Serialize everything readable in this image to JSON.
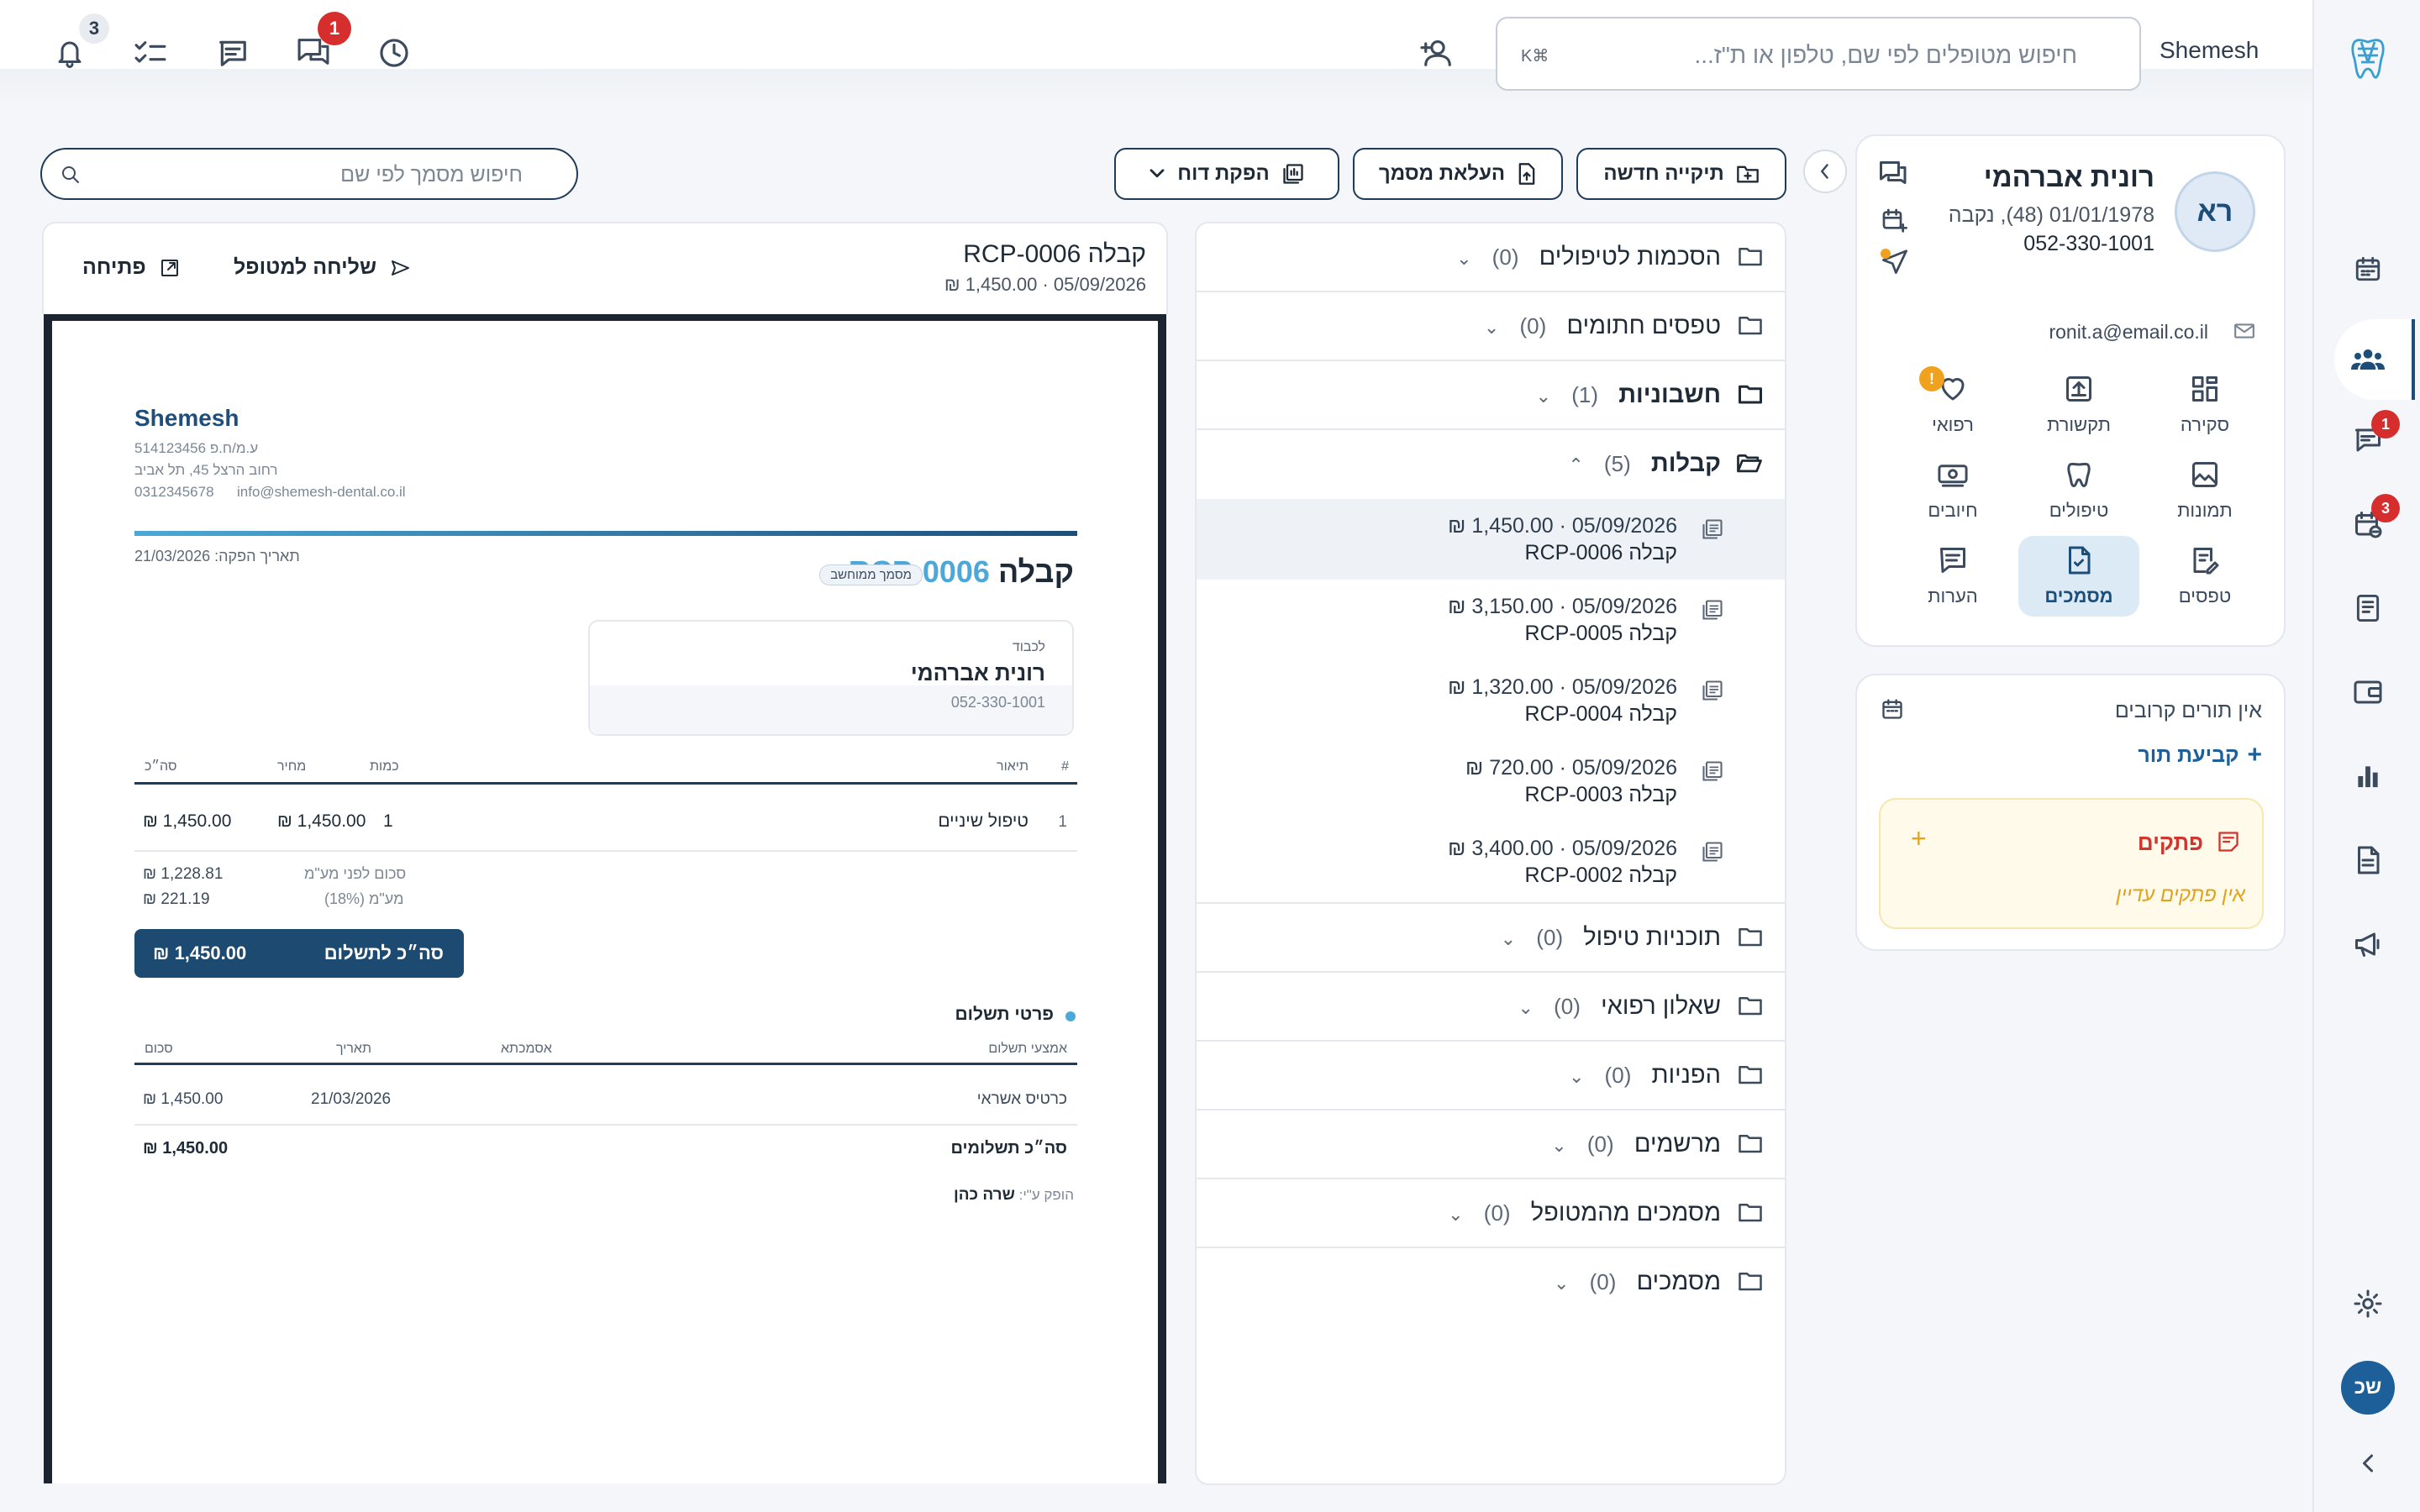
{
  "topbar": {
    "brand": "Shemesh",
    "search_placeholder": "חיפוש מטופלים לפי שם, טלפון או ת\"ז...",
    "kbd_hint": "K⌘",
    "notifications_count": "3",
    "messages_count": "1"
  },
  "rail": {
    "user_initials": "שכ",
    "messages_badge": "1",
    "calendar_badge": "3"
  },
  "patient": {
    "name": "רונית אברהמי",
    "initials": "רא",
    "details": "01/01/1978 (48), נקבה",
    "phone": "052-330-1001",
    "email": "ronit.a@email.co.il",
    "tiles": [
      "סקירה",
      "תקשורת",
      "רפואי",
      "תמונות",
      "טיפולים",
      "חיובים",
      "טפסים",
      "מסמכים",
      "הערות"
    ],
    "medical_alert": "!"
  },
  "appointments": {
    "none_text": "אין תורים קרובים",
    "book_label": "קביעת תור"
  },
  "notes": {
    "title": "פתקים",
    "empty": "אין פתקים עדיין"
  },
  "toolbar": {
    "new_folder": "תיקייה חדשה",
    "upload": "העלאת מסמך",
    "report": "הפקת דוח",
    "doc_search_placeholder": "חיפוש מסמך לפי שם"
  },
  "folders": [
    {
      "label": "הסכמות לטיפולים",
      "count": "(0)"
    },
    {
      "label": "טפסים חתומים",
      "count": "(0)"
    },
    {
      "label": "חשבוניות",
      "count": "(1)"
    },
    {
      "label": "קבלות",
      "count": "(5)"
    },
    {
      "label": "תוכניות טיפול",
      "count": "(0)"
    },
    {
      "label": "שאלון רפואי",
      "count": "(0)"
    },
    {
      "label": "הפניות",
      "count": "(0)"
    },
    {
      "label": "מרשמים",
      "count": "(0)"
    },
    {
      "label": "מסמכים מהמטופל",
      "count": "(0)"
    },
    {
      "label": "מסמכים",
      "count": "(0)"
    }
  ],
  "receipts": [
    {
      "meta": "₪ 1,450.00 · 05/09/2026",
      "name": "קבלה RCP-0006"
    },
    {
      "meta": "₪ 3,150.00 · 05/09/2026",
      "name": "קבלה RCP-0005"
    },
    {
      "meta": "₪ 1,320.00 · 05/09/2026",
      "name": "קבלה RCP-0004"
    },
    {
      "meta": "₪ 720.00 · 05/09/2026",
      "name": "קבלה RCP-0003"
    },
    {
      "meta": "₪ 3,400.00 · 05/09/2026",
      "name": "קבלה RCP-0002"
    }
  ],
  "preview": {
    "title": "קבלה RCP-0006",
    "meta": "₪ 1,450.00 · 05/09/2026",
    "send_label": "שליחה למטופל",
    "open_label": "פתיחה"
  },
  "doc": {
    "clinic": "Shemesh",
    "tax_id": "ע.מ/ח.פ 514123456",
    "address": "רחוב הרצל 45, תל אביב",
    "phone": "0312345678",
    "email": "info@shemesh-dental.co.il",
    "issue_date": "תאריך הפקה: 21/03/2026",
    "doc_word": "קבלה",
    "doc_number": "RCP-0006",
    "computerized": "מסמך ממוחשב",
    "to_label": "לכבוד",
    "to_name": "רונית אברהמי",
    "to_phone": "052-330-1001",
    "cols": {
      "num": "#",
      "desc": "תיאור",
      "qty": "כמות",
      "price": "מחיר",
      "total": "סה״כ"
    },
    "line": {
      "num": "1",
      "desc": "טיפול שיניים",
      "qty": "1",
      "price": "1,450.00 ₪",
      "total": "1,450.00 ₪"
    },
    "subtotal_label": "סכום לפני מע\"מ",
    "subtotal": "1,228.81 ₪",
    "vat_label": "מע\"מ (18%)",
    "vat": "221.19 ₪",
    "grand_label": "סה״כ לתשלום",
    "grand": "1,450.00 ₪",
    "pay_title": "פרטי תשלום",
    "pay_cols": {
      "method": "אמצעי תשלום",
      "ref": "אסמכתא",
      "date": "תאריך",
      "amount": "סכום"
    },
    "pay_row": {
      "method": "כרטיס אשראי",
      "date": "21/03/2026",
      "amount": "1,450.00 ₪"
    },
    "pay_total_label": "סה״כ תשלומים",
    "pay_total": "1,450.00 ₪",
    "issued_by_label": "הופק ע\"י:",
    "issued_by": "שרה כהן"
  },
  "colors": {
    "primary": "#1d4e7a",
    "accent": "#4ba8d8",
    "badge": "#d62d2d",
    "notes_bg": "#fffaea"
  }
}
